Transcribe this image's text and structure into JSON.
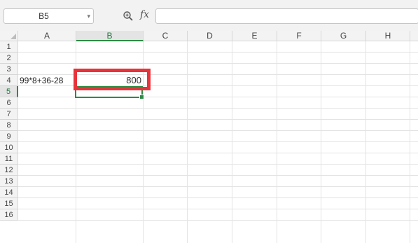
{
  "formula_bar": {
    "name_box_value": "B5",
    "fx_label": "fx",
    "formula_value": ""
  },
  "columns": [
    "A",
    "B",
    "C",
    "D",
    "E",
    "F",
    "G",
    "H"
  ],
  "rows": [
    "1",
    "2",
    "3",
    "4",
    "5",
    "6",
    "7",
    "8",
    "9",
    "10",
    "11",
    "12",
    "13",
    "14",
    "15",
    "16"
  ],
  "cells": {
    "A4": "99*8+36-28",
    "B4": "800"
  },
  "selection": {
    "active_cell": "B5",
    "column": "B",
    "row": "5"
  },
  "colors": {
    "highlight": "#e8333a",
    "selection": "#2e8b45"
  }
}
